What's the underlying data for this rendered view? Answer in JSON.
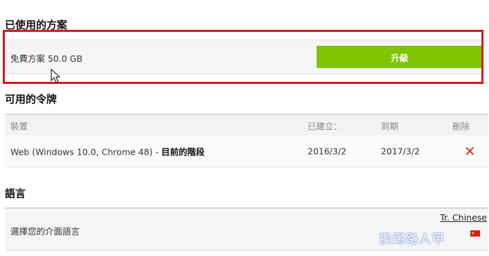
{
  "sections": {
    "plan_title": "已使用的方案",
    "tokens_title": "可用的令牌",
    "language_title": "語言"
  },
  "plan": {
    "name": "免費方案 50.0 GB",
    "upgrade_label": "升級"
  },
  "tokens": {
    "columns": {
      "device": "裝置",
      "created": "已建立：",
      "expires": "到期",
      "delete": "刪除"
    },
    "rows": [
      {
        "device": "Web (Windows 10.0, Chrome 48) - ",
        "current": "目前的階段",
        "created": "2016/3/2",
        "expires": "2017/3/2"
      }
    ]
  },
  "language": {
    "label": "選擇您的介面語言",
    "current": "Tr. Chinese"
  },
  "watermark": "挨踢路人甲",
  "colors": {
    "accent": "#7ec400",
    "highlight": "#e0141a",
    "delete": "#d8331c"
  },
  "icons": {
    "delete": "x-icon",
    "flag": "flag-icon",
    "cursor": "mouse-pointer-icon"
  }
}
